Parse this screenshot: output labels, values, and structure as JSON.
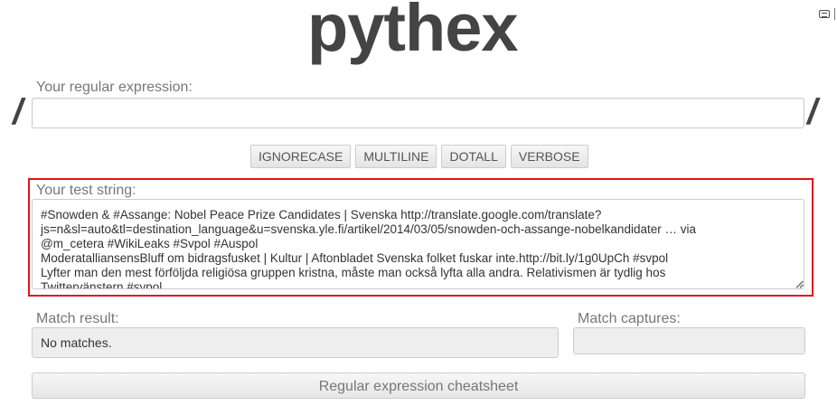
{
  "header": {
    "logo": "pythex"
  },
  "corner": {
    "icon": "keyboard-icon"
  },
  "regex": {
    "label": "Your regular expression:",
    "value": "",
    "delimiter_left": "/",
    "delimiter_right": "/"
  },
  "flags": [
    {
      "label": "IGNORECASE"
    },
    {
      "label": "MULTILINE"
    },
    {
      "label": "DOTALL"
    },
    {
      "label": "VERBOSE"
    }
  ],
  "test_string": {
    "label": "Your test string:",
    "lines": [
      "#Snowden & #Assange: Nobel Peace Prize Candidates | Svenska http://translate.google.com/translate?",
      "js=n&sl=auto&tl=destination_language&u=svenska.yle.fi/artikel/2014/03/05/snowden-och-assange-nobelkandidater … via",
      "@m_cetera #WikiLeaks #Svpol #Auspol",
      "ModeratalliansensBluff om bidragsfusket | Kultur | Aftonbladet Svenska folket fuskar inte.http://bit.ly/1g0UpCh  #svpol",
      "Lyfter man den mest förföljda religiösa gruppen kristna, måste man också lyfta alla andra. Relativismen är tydlig hos",
      "Twittervänstern #svpol"
    ],
    "highlight_color": "#e0121a"
  },
  "match_result": {
    "label": "Match result:",
    "value": "No matches."
  },
  "match_captures": {
    "label": "Match captures:",
    "value": ""
  },
  "cheatsheet": {
    "label": "Regular expression cheatsheet"
  }
}
